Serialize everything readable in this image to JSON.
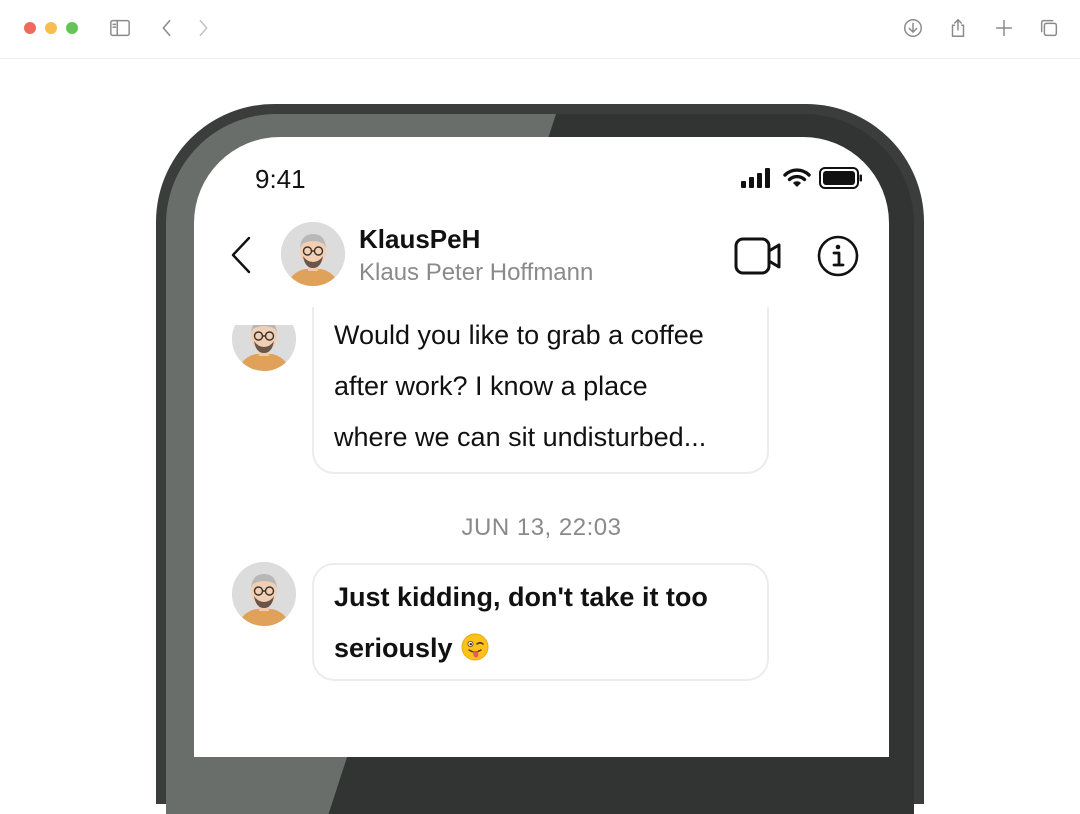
{
  "browser": {
    "icons": [
      "sidebar-icon",
      "back-icon",
      "forward-icon",
      "download-icon",
      "share-icon",
      "new-tab-icon",
      "tabs-icon"
    ]
  },
  "status_bar": {
    "time": "9:41"
  },
  "chat_header": {
    "username": "KlausPeH",
    "full_name": "Klaus Peter Hoffmann"
  },
  "messages": [
    {
      "lines": [
        "Would you like to grab a coffee",
        "after work? I know a place",
        "where we can sit undisturbed..."
      ]
    },
    {
      "date_divider": "JUN 13, 22:03",
      "lines": [
        "Just kidding, don't take it too",
        "seriously"
      ],
      "emoji": "winking-face-with-tongue"
    }
  ],
  "colors": {
    "accent_dark": "#111111",
    "muted_text": "#8a8a8a",
    "phone_frame": "#3a3d3b",
    "bubble_border": "#ececec"
  }
}
